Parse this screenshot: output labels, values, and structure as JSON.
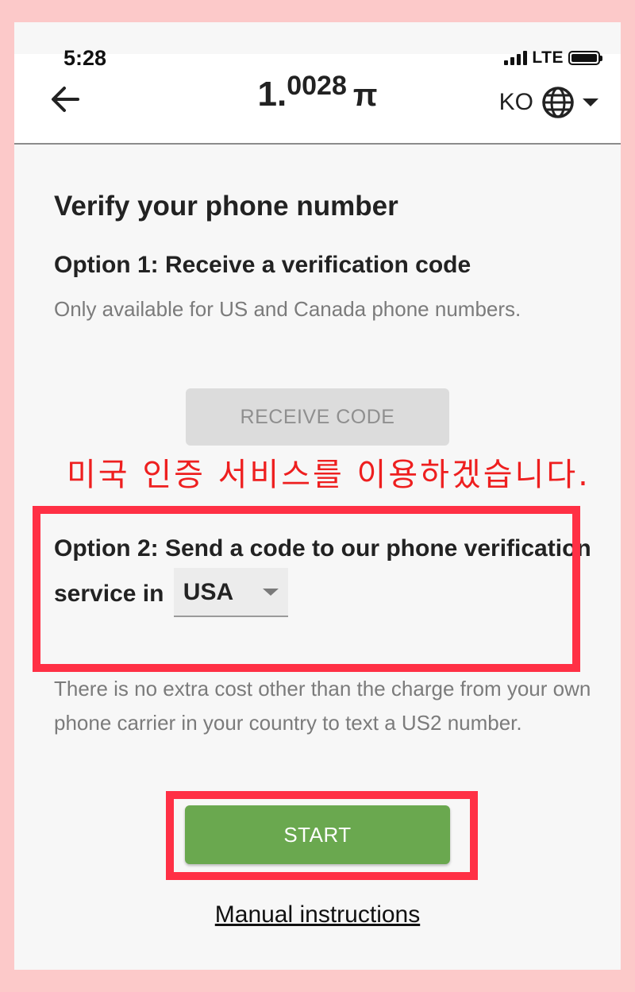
{
  "status_bar": {
    "time": "5:28",
    "network": "LTE"
  },
  "header": {
    "back_icon": "arrow-left-icon",
    "balance_integer": "1.",
    "balance_decimal": "0028",
    "currency_symbol": "π",
    "language_code": "KO",
    "language_icon": "globe-icon"
  },
  "main": {
    "title": "Verify your phone number",
    "option1": {
      "title": "Option 1: Receive a verification code",
      "description": "Only available for US and Canada phone numbers.",
      "button_label": "RECEIVE CODE"
    },
    "annotation_note": "미국 인증 서비스를 이용하겠습니다.",
    "option2": {
      "title_prefix": "Option 2: Send a code to our phone verification service in",
      "country_selected": "USA",
      "description": "There is no extra cost other than the charge from your own phone carrier in your country to text a US2 number.",
      "start_button_label": "START"
    },
    "manual_link": "Manual instructions"
  },
  "colors": {
    "page_border": "#fcc9c9",
    "highlight_box": "#ff3045",
    "annotation_text": "#ee1f1f",
    "start_button": "#6aa84f",
    "disabled_button": "#dcdcdc"
  }
}
